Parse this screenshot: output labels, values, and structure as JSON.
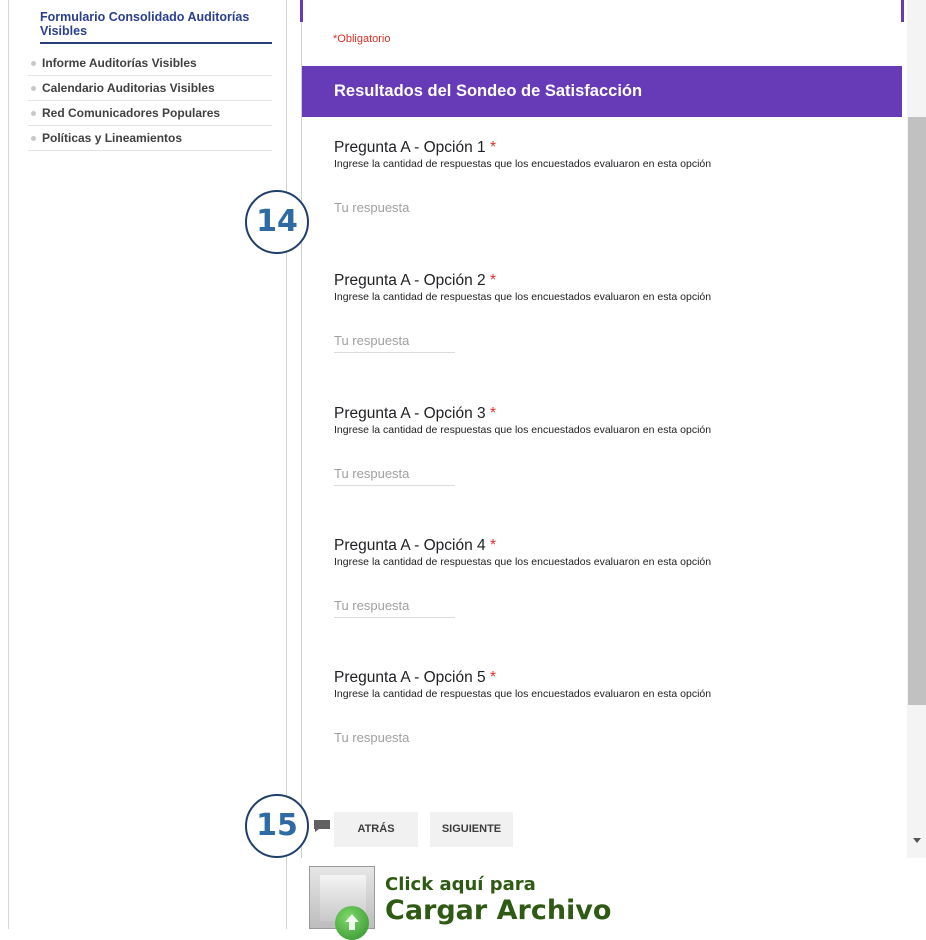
{
  "sidebar": {
    "active": "Formulario Consolidado Auditorías Visibles",
    "items": [
      {
        "label": "Informe Auditorías Visibles"
      },
      {
        "label": "Calendario Auditorias Visibles"
      },
      {
        "label": "Red Comunicadores Populares"
      },
      {
        "label": "Políticas y Lineamientos"
      }
    ]
  },
  "form": {
    "required_note": "*Obligatorio",
    "section_title": "Resultados del Sondeo de Satisfacción",
    "questions": [
      {
        "title": "Pregunta A - Opción 1",
        "required": "*",
        "description": "Ingrese la cantidad de respuestas que los encuestados evaluaron en esta opción",
        "placeholder": "Tu respuesta"
      },
      {
        "title": "Pregunta A - Opción 2",
        "required": "*",
        "description": "Ingrese la cantidad de respuestas que los encuestados evaluaron en esta opción",
        "placeholder": "Tu respuesta"
      },
      {
        "title": "Pregunta A - Opción 3",
        "required": "*",
        "description": "Ingrese la cantidad de respuestas que los encuestados evaluaron en esta opción",
        "placeholder": "Tu respuesta"
      },
      {
        "title": "Pregunta A - Opción 4",
        "required": "*",
        "description": "Ingrese la cantidad de respuestas que los encuestados evaluaron en esta opción",
        "placeholder": "Tu respuesta"
      },
      {
        "title": "Pregunta A - Opción 5",
        "required": "*",
        "description": "Ingrese la cantidad de respuestas que los encuestados evaluaron en esta opción",
        "placeholder": "Tu respuesta"
      }
    ],
    "back_label": "ATRÁS",
    "next_label": "SIGUIENTE"
  },
  "callouts": {
    "first": "14",
    "second": "15"
  },
  "upload": {
    "line1": "Click aquí para",
    "line2": "Cargar Archivo"
  },
  "colors": {
    "accent": "#673ab7",
    "required": "#d93025",
    "upload_text": "#2f5a14"
  }
}
